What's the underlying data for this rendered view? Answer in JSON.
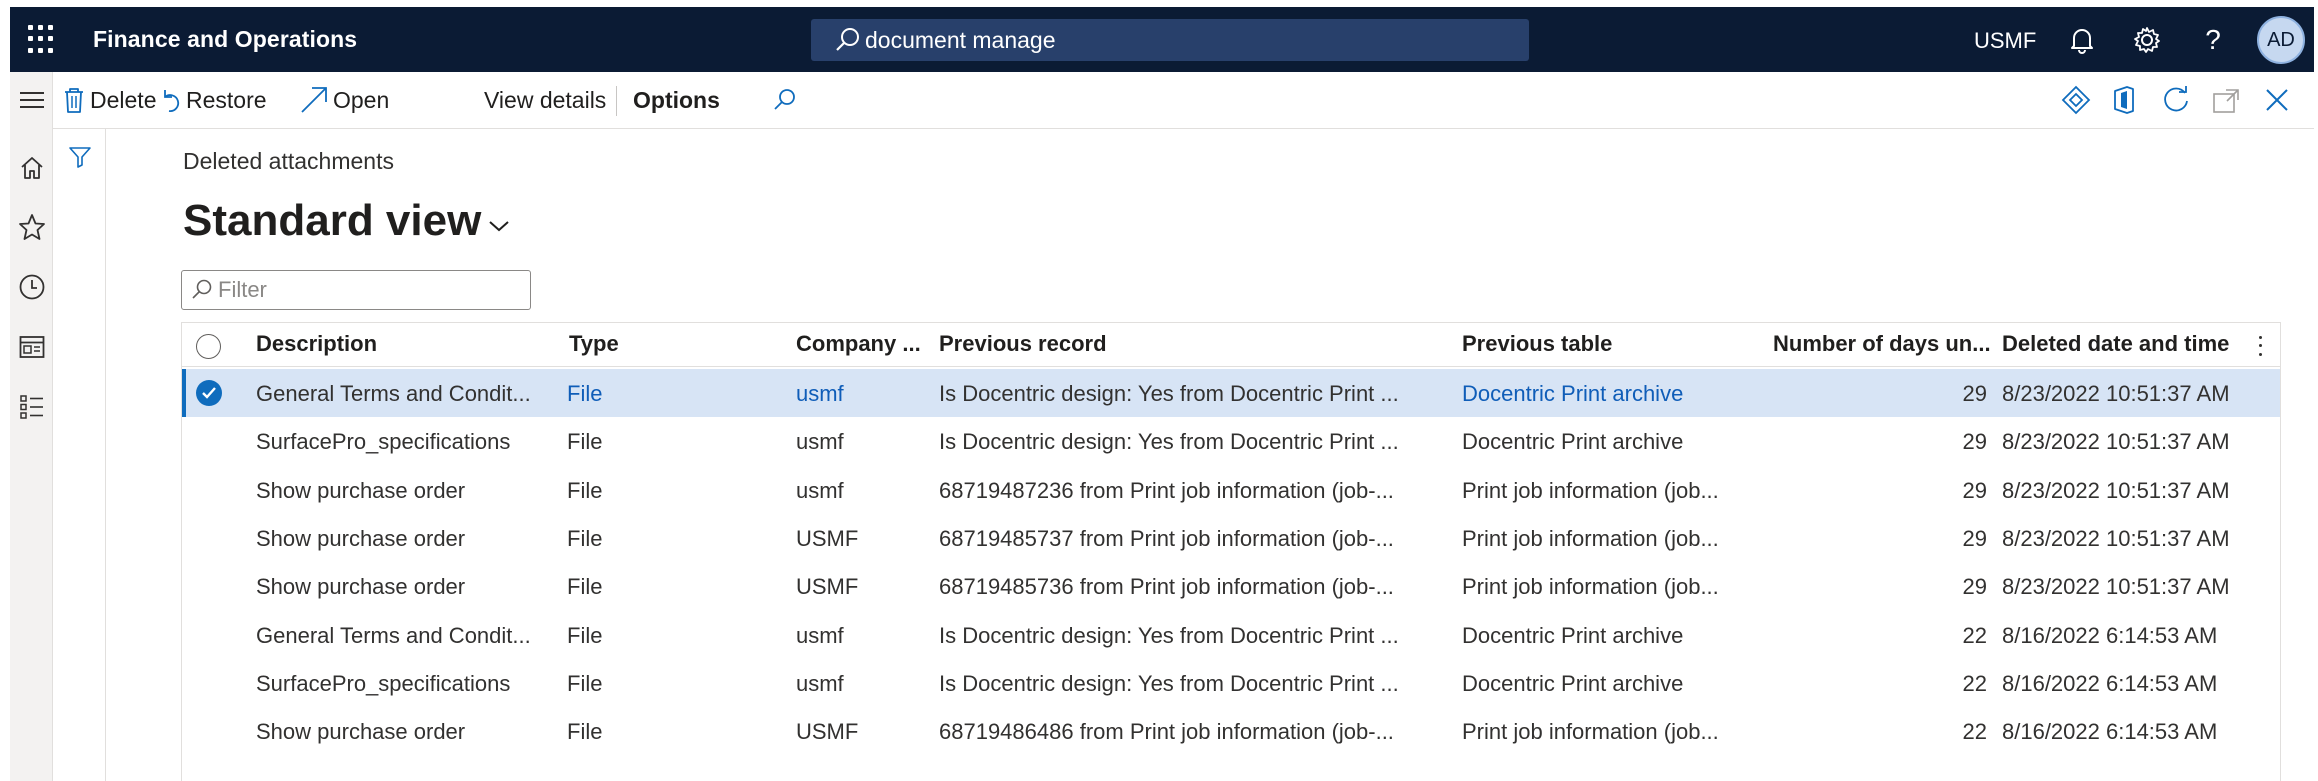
{
  "topbar": {
    "app_title": "Finance and Operations",
    "search_value": "document manage",
    "company": "USMF",
    "help_label": "?",
    "avatar_initials": "AD",
    "bg_color": "#0b1b34"
  },
  "leftnav": {
    "items": [
      "menu-icon",
      "home-icon",
      "favorites-star-icon",
      "recent-clock-icon",
      "workspaces-icon",
      "modules-list-icon"
    ]
  },
  "actionpane": {
    "delete_label": "Delete",
    "restore_label": "Restore",
    "open_label": "Open",
    "view_details_label": "View details",
    "options_label": "Options"
  },
  "page": {
    "breadcrumb": "Deleted attachments",
    "view_name": "Standard view",
    "filter_placeholder": "Filter"
  },
  "grid": {
    "columns": {
      "description": "Description",
      "type": "Type",
      "company": "Company ...",
      "previous_record": "Previous record",
      "previous_table": "Previous table",
      "days": "Number of days un...",
      "deleted": "Deleted date and time"
    },
    "rows": [
      {
        "description": "General Terms and Condit...",
        "type": "File",
        "company": "usmf",
        "previous_record": "Is Docentric design: Yes from Docentric Print ...",
        "previous_table": "Docentric Print archive",
        "days": "29",
        "deleted": "8/23/2022 10:51:37 AM"
      },
      {
        "description": "SurfacePro_specifications",
        "type": "File",
        "company": "usmf",
        "previous_record": "Is Docentric design: Yes from Docentric Print ...",
        "previous_table": "Docentric Print archive",
        "days": "29",
        "deleted": "8/23/2022 10:51:37 AM"
      },
      {
        "description": "Show purchase order",
        "type": "File",
        "company": "usmf",
        "previous_record": "68719487236 from Print job information (job-...",
        "previous_table": "Print job information (job...",
        "days": "29",
        "deleted": "8/23/2022 10:51:37 AM"
      },
      {
        "description": "Show purchase order",
        "type": "File",
        "company": "USMF",
        "previous_record": "68719485737 from Print job information (job-...",
        "previous_table": "Print job information (job...",
        "days": "29",
        "deleted": "8/23/2022 10:51:37 AM"
      },
      {
        "description": "Show purchase order",
        "type": "File",
        "company": "USMF",
        "previous_record": "68719485736 from Print job information (job-...",
        "previous_table": "Print job information (job...",
        "days": "29",
        "deleted": "8/23/2022 10:51:37 AM"
      },
      {
        "description": "General Terms and Condit...",
        "type": "File",
        "company": "usmf",
        "previous_record": "Is Docentric design: Yes from Docentric Print ...",
        "previous_table": "Docentric Print archive",
        "days": "22",
        "deleted": "8/16/2022 6:14:53 AM"
      },
      {
        "description": "SurfacePro_specifications",
        "type": "File",
        "company": "usmf",
        "previous_record": "Is Docentric design: Yes from Docentric Print ...",
        "previous_table": "Docentric Print archive",
        "days": "22",
        "deleted": "8/16/2022 6:14:53 AM"
      },
      {
        "description": "Show purchase order",
        "type": "File",
        "company": "USMF",
        "previous_record": "68719486486 from Print job information (job-...",
        "previous_table": "Print job information (job...",
        "days": "22",
        "deleted": "8/16/2022 6:14:53 AM"
      }
    ],
    "selected_row_index": 0,
    "selected_color": "#d7e4f5",
    "link_color": "#0f5db8"
  }
}
